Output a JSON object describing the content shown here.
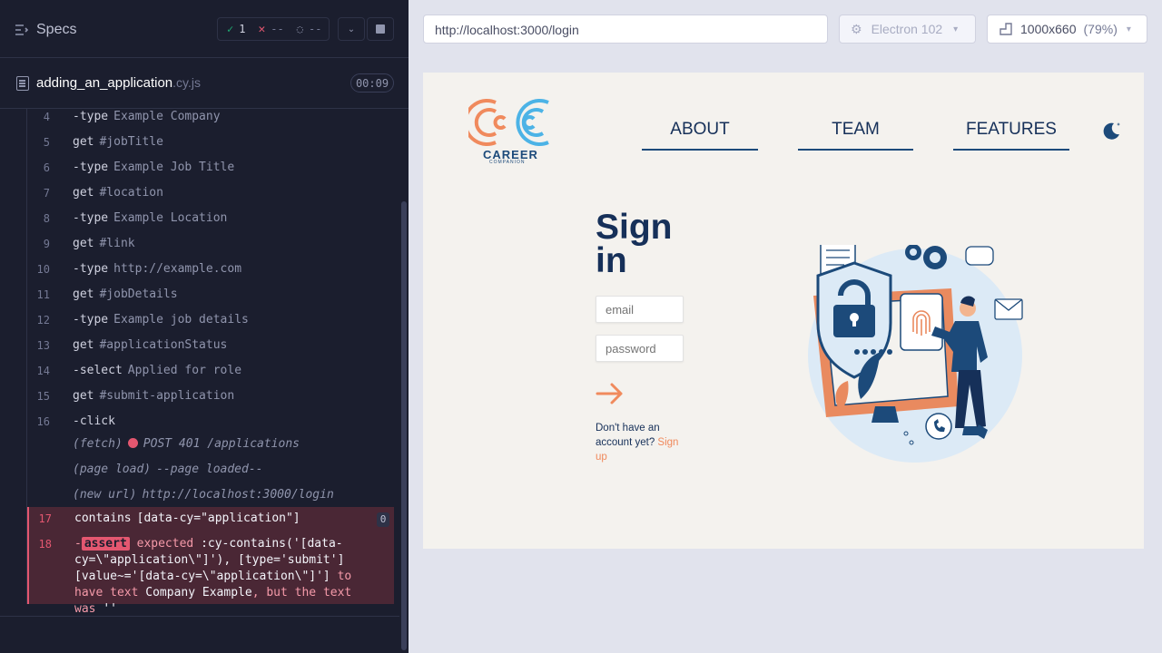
{
  "reporter": {
    "specs_label": "Specs",
    "stats": {
      "passed": "1",
      "failed": "--",
      "pending": "--"
    },
    "file": {
      "name": "adding_an_application",
      "ext": ".cy.js",
      "duration": "00:09"
    },
    "commands": [
      {
        "n": "4",
        "name": "-type",
        "arg": "Example Company"
      },
      {
        "n": "5",
        "name": "get",
        "arg": "#jobTitle"
      },
      {
        "n": "6",
        "name": "-type",
        "arg": "Example Job Title"
      },
      {
        "n": "7",
        "name": "get",
        "arg": "#location"
      },
      {
        "n": "8",
        "name": "-type",
        "arg": "Example Location"
      },
      {
        "n": "9",
        "name": "get",
        "arg": "#link"
      },
      {
        "n": "10",
        "name": "-type",
        "arg": "http://example.com"
      },
      {
        "n": "11",
        "name": "get",
        "arg": "#jobDetails"
      },
      {
        "n": "12",
        "name": "-type",
        "arg": "Example job details"
      },
      {
        "n": "13",
        "name": "get",
        "arg": "#applicationStatus"
      },
      {
        "n": "14",
        "name": "-select",
        "arg": "Applied for role"
      },
      {
        "n": "15",
        "name": "get",
        "arg": "#submit-application"
      },
      {
        "n": "16",
        "name": "-click",
        "arg": ""
      }
    ],
    "events": [
      {
        "name": "(fetch)",
        "arg": "POST 401 /applications"
      },
      {
        "name": "(page load)",
        "arg": "--page loaded--"
      },
      {
        "name": "(new url)",
        "arg": "http://localhost:3000/login"
      }
    ],
    "failed_contains": {
      "n": "17",
      "name": "contains",
      "arg": "[data-cy=\"application\"]",
      "badge": "0"
    },
    "failed_assert": {
      "n": "18",
      "dash": "-",
      "tag": "assert",
      "expected": "expected",
      "selector": ":cy-contains('[data-cy=\\\"application\\\"]'), [type='submit'][value~='[data-cy=\\\"application\\\"]']",
      "to_have": "to have text",
      "text": "Company Example",
      "but": ", but the text was",
      "was": "''"
    }
  },
  "aut": {
    "url": "http://localhost:3000/login",
    "browser": "Electron 102",
    "viewport": "1000x660",
    "scale": "(79%)"
  },
  "app": {
    "logo_title": "CAREER",
    "logo_subtitle": "COMPANION",
    "nav": {
      "about": "ABOUT",
      "team": "TEAM",
      "features": "FEATURES"
    },
    "signin_title": "Sign in",
    "email_placeholder": "email",
    "password_placeholder": "password",
    "signup_prefix": "Don't have an account yet?",
    "signup_link": "Sign up"
  },
  "colors": {
    "reporter_bg": "#1b1e2e",
    "fail_red": "#e45770",
    "pass_green": "#1fa971",
    "app_navy": "#163059",
    "app_orange": "#f08a5d",
    "app_bg": "#f4f2ee"
  },
  "icons": [
    "specs-icon",
    "check-icon",
    "x-icon",
    "spinner-icon",
    "chevron-down-icon",
    "stop-icon",
    "file-icon",
    "electron-icon",
    "ruler-icon",
    "moon-icon",
    "arrow-right-icon"
  ]
}
